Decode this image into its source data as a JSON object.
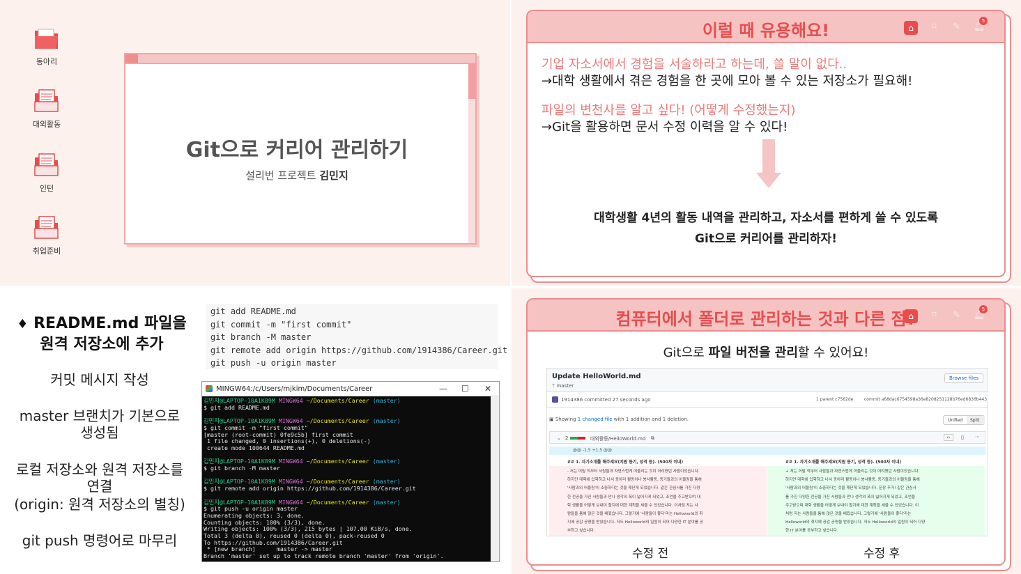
{
  "colors": {
    "page_bg": "#fdf1ee",
    "accent_pink": "#ee8c8c",
    "header_pink": "#f6c3c3",
    "title_red": "#e84d4d",
    "question_pink": "#f07a7a"
  },
  "slide1": {
    "folders": [
      {
        "label": "동아리",
        "icon": "folder-open-icon"
      },
      {
        "label": "대외활동",
        "icon": "folder-document-icon"
      },
      {
        "label": "인턴",
        "icon": "folder-document-icon"
      },
      {
        "label": "취업준비",
        "icon": "folder-document-icon"
      }
    ],
    "title": "Git으로 커리어 관리하기",
    "subtitle_prefix": "설리번 프로젝트 ",
    "subtitle_name": "김민지"
  },
  "slide2": {
    "header_title": "이럴 때 유용해요!",
    "header_badge": "5",
    "q1": "기업 자소서에서 경험을 서술하라고 하는데, 쓸 말이 없다..",
    "a1": "→대학 생활에서 겪은 경험을 한 곳에 모아 볼 수 있는 저장소가 필요해!",
    "q2": "파일의 변천사를 알고 싶다! (어떻게 수정했는지)",
    "a2": "→Git을 활용하면 문서 수정 이력을 알 수 있다!",
    "conclusion_line1": "대학생활 4년의 활동 내역을 관리하고, 자소서를 편하게 쓸 수 있도록",
    "conclusion_line2": "Git으로 커리어를 관리하자!"
  },
  "slide3": {
    "heading_line1": "README.md 파일을",
    "heading_line2": "원격 저장소에 추가",
    "steps": [
      "커밋 메시지 작성",
      "master 브랜치가 기본으로",
      "생성됨",
      "로컬 저장소와 원격 저장소를",
      "연결",
      "(origin: 원격 저장소의 별칭)",
      "git push 명령어로 마무리"
    ],
    "code_lines": [
      "git add README.md",
      "git commit -m \"first commit\"",
      "git branch -M master",
      "git remote add origin https://github.com/1914386/Career.git",
      "git push -u origin master"
    ],
    "terminal_title": "MINGW64:/c/Users/mjkim/Documents/Career",
    "terminal": {
      "prompt_user": "김민지@LAPTOP-10A1K89M",
      "prompt_env": "MINGW64",
      "prompt_path": "~/Documents/Career",
      "prompt_branch": "(master)",
      "cmd1": "$ git add README.md",
      "cmd2": "$ git commit -m \"first commit\"",
      "out2": [
        "[master (root-commit) 0fe9c5b] first commit",
        " 1 file changed, 0 insertions(+), 0 deletions(-)",
        " create mode 100644 README.md"
      ],
      "cmd3": "$ git branch -M master",
      "cmd4": "$ git remote add origin https://github.com/1914386/Career.git",
      "cmd5": "$ git push -u origin master",
      "out5": [
        "Enumerating objects: 3, done.",
        "Counting objects: 100% (3/3), done.",
        "Writing objects: 100% (3/3), 215 bytes | 107.00 KiB/s, done.",
        "Total 3 (delta 0), reused 0 (delta 0), pack-reused 0",
        "To https://github.com/1914386/Career.git",
        " * [new branch]      master -> master",
        "Branch 'master' set up to track remote branch 'master' from 'origin'."
      ]
    }
  },
  "slide4": {
    "header_title": "컴퓨터에서 폴더로 관리하는 것과 다른 점?",
    "header_badge": "5",
    "subtitle_prefix": "Git으로 ",
    "subtitle_bold": "파일 버전을 관리",
    "subtitle_suffix": "할 수 있어요!",
    "github": {
      "commit_title": "Update HelloWorld.md",
      "branch": "master",
      "browse_files": "Browse files",
      "author_line": "1914386 committed 27 seconds ago",
      "parent": "1 parent c7562de",
      "commit": "commit a68dac6754598a36e8208251128b76ed6836b443",
      "showing_prefix": "Showing ",
      "showing_link": "1 changed file",
      "showing_suffix": " with 1 addition and 1 deletion.",
      "unified": "Unified",
      "split": "Split",
      "file_count": "2",
      "file_path": "대외활동/HelloWorld.md",
      "hunk": "@@ -1,5 +1,5 @@",
      "left_heading": "## 1. 자기소개를 해주세요(지원 동기, 성격 등). (500자 이내)",
      "right_heading": "## 1. 자기소개를 해주세요(지원 동기, 성격 등). (500자 이내)",
      "left_lines": [
        "- 저는 어릴 적부터 사람들과 자연스럽게 어울리는 것이 어려웠던 사람이었습니다.",
        "하지만 대학에 입학하고 나서 동아리 활동이나 봉사활동, 동기들과의 어울림을 통해",
        "'사람과의 어울림'이 소중하다는 것을 깨닫게 되었습니다. 같은 관심사를 가진 다양",
        "한 전공을 가진 사람들과 만나 생각의 폭이 넓어지게 되었고, 조언을 주고받으며 대",
        "학 생활을 어떻게 보내야 할지에 대한 계획을 세울 수 있었습니다. 이처럼 저는 사",
        "람들을 통해 많은 것을 배웠습니다. 그렇기에 '사람들이 좋다'라는 Helloworld의 취",
        "지에 공감 공명을 받았습니다. 저도 Helloworld의 일원이 되어 다양한 IT 분야를 공",
        "부하고 싶습니다."
      ],
      "right_lines": [
        "+ 저는 어릴 적부터 사람들과 자연스럽게 어울리는 것이 어려웠던 사람이었습니다.",
        "하지만 대학에 입학하고 나서 동아리 활동이나 봉사활동, 동기들과의 어울림을 통해",
        "'사람과의 어울림'이 소중하다는 것을 깨닫게 되었습니다. 문장 추가! 같은 관심사",
        "를 가진 다양한 전공을 가진 사람들과 만나 생각의 폭이 넓어지게 되었고, 조언을",
        "주고받으며 대학 생활을 어떻게 보내야 할지에 대한 계획을 세울 수 있었습니다. 이",
        "처럼 저는 사람들을 통해 많은 것을 배웠습니다. 그렇기에 '사람들이 좋다'라는",
        "Helloworld의 취지에 공감 공명을 받았습니다. 저도 Helloworld의 일원이 되어 다양",
        "한 IT 분야를 공부하고 싶습니다."
      ]
    },
    "before_label": "수정 전",
    "after_label": "수정 후"
  }
}
